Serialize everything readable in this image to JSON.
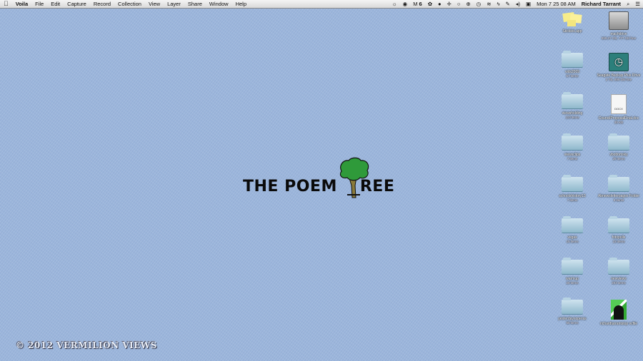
{
  "menubar": {
    "apple": "",
    "app": "Voila",
    "items": [
      "File",
      "Edit",
      "Capture",
      "Record",
      "Collection",
      "View",
      "Layer",
      "Share",
      "Window",
      "Help"
    ],
    "status_icons": [
      "brightness-icon",
      "wheel-icon",
      "m6-icon",
      "paw-icon",
      "dropbox-icon",
      "crosshair-icon",
      "chat-icon",
      "timemachine-icon",
      "clock-icon",
      "wifi-icon",
      "power-icon",
      "pen-icon",
      "volume-icon",
      "display-icon"
    ],
    "status_text": "6",
    "clock": "Mon 7 25 08 AM",
    "user": "Richard Tarrant"
  },
  "desktop": {
    "icons_left": [
      {
        "name": "Stickies.app",
        "sub": "",
        "kind": "stickies"
      },
      {
        "name": "vids2009",
        "sub": "57 items",
        "kind": "folder"
      },
      {
        "name": "viewsholding",
        "sub": "110 items",
        "kind": "folder"
      },
      {
        "name": "viewsclips",
        "sub": "7 items",
        "kind": "folder"
      },
      {
        "name": "schoolshistory13",
        "sub": "7 items",
        "kind": "folder"
      },
      {
        "name": "vegas",
        "sub": "15 items",
        "kind": "folder"
      },
      {
        "name": "warmup",
        "sub": "26 items",
        "kind": "folder"
      },
      {
        "name": "yesterdaysoperas",
        "sub": "55 items",
        "kind": "folder"
      }
    ],
    "icons_right": [
      {
        "name": "machdrive",
        "sub": "999.37 GB, 777 GB free",
        "kind": "hd"
      },
      {
        "name": "Seagate Backup Plus Drive",
        "sub": "2 TB, 999 GB free",
        "kind": "timemachine"
      },
      {
        "name": "CouncilProposalFinal.doc",
        "sub": "35 KB",
        "kind": "docx",
        "badge": "DOCX"
      },
      {
        "name": "vbottomsky",
        "sub": "26 items",
        "kind": "folder"
      },
      {
        "name": "Abnewsletterpages Folder",
        "sub": "9 items",
        "kind": "folder"
      },
      {
        "name": "fotopolls",
        "sub": "15 items",
        "kind": "folder"
      },
      {
        "name": "newviews",
        "sub": "203 items",
        "kind": "folder"
      },
      {
        "name": "richardtarrantstop vcfile",
        "sub": "",
        "kind": "vcard"
      }
    ]
  },
  "logo": {
    "left": "THE POEM",
    "right": "REE"
  },
  "copyright": "© 2012 VERMILION VIEWS"
}
